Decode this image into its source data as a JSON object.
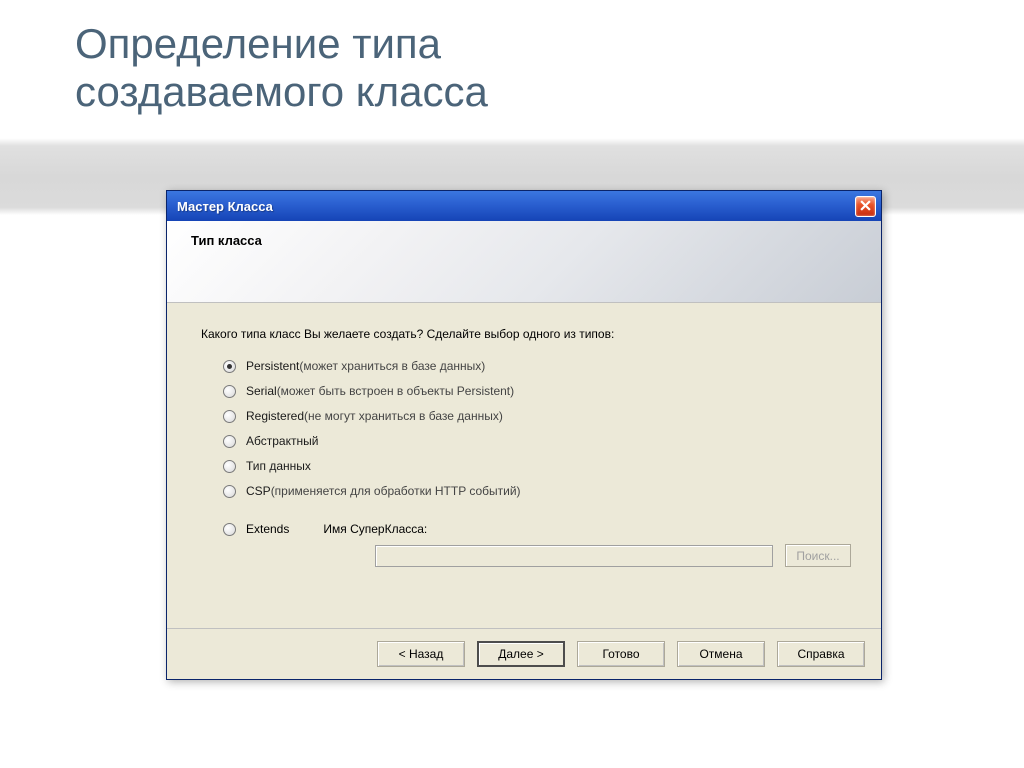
{
  "slide": {
    "title_line1": "Определение типа",
    "title_line2": "создаваемого класса"
  },
  "dialog": {
    "title": "Мастер Класса",
    "header_label": "Тип класса",
    "prompt": "Какого типа класс Вы желаете создать? Сделайте выбор одного из типов:",
    "options": {
      "persistent": {
        "label": "Persistent",
        "hint": "  (может храниться в базе данных)"
      },
      "serial": {
        "label": "Serial",
        "hint": "   (может быть встроен в объекты Persistent)"
      },
      "registered": {
        "label": "Registered",
        "hint": "  (не могут храниться в базе данных)"
      },
      "abstract": {
        "label": "Абстрактный",
        "hint": ""
      },
      "datatype": {
        "label": "Тип данных",
        "hint": ""
      },
      "csp": {
        "label": "CSP",
        "hint": "  (применяется для обработки HTTP событий)"
      },
      "extends": {
        "label": "Extends"
      }
    },
    "superclass_label": "Имя СуперКласса:",
    "superclass_value": "",
    "browse_label": "Поиск...",
    "buttons": {
      "back": "< Назад",
      "next": "Далее >",
      "finish": "Готово",
      "cancel": "Отмена",
      "help": "Справка"
    }
  }
}
